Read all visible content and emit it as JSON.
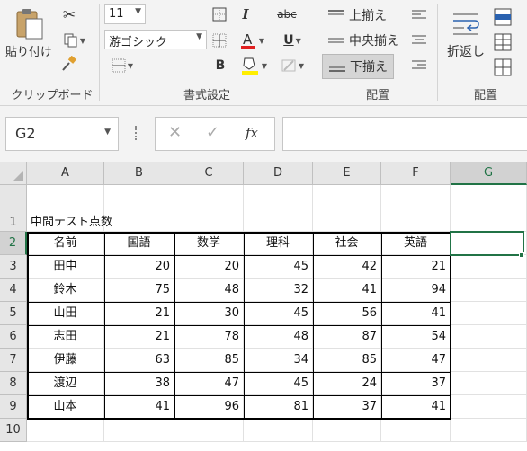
{
  "ribbon": {
    "clipboard": {
      "paste_label": "貼り付け",
      "group_label": "クリップボード"
    },
    "font": {
      "size": "11",
      "family": "游ゴシック",
      "group_label": "書式設定",
      "italic": "I",
      "strike": "abc",
      "bold": "B",
      "underline": "U"
    },
    "align": {
      "top": "上揃え",
      "middle": "中央揃え",
      "bottom": "下揃え",
      "group_label": "配置"
    },
    "wrap": {
      "label": "折返し",
      "group_label": "配置"
    }
  },
  "formula_bar": {
    "name_box": "G2",
    "fx": "fx"
  },
  "columns": [
    "A",
    "B",
    "C",
    "D",
    "E",
    "F",
    "G"
  ],
  "rows": [
    "1",
    "2",
    "3",
    "4",
    "5",
    "6",
    "7",
    "8",
    "9",
    "10"
  ],
  "sheet": {
    "title": "中間テスト点数",
    "headers": [
      "名前",
      "国語",
      "数学",
      "理科",
      "社会",
      "英語"
    ],
    "records": [
      [
        "田中",
        "20",
        "20",
        "45",
        "42",
        "21"
      ],
      [
        "鈴木",
        "75",
        "48",
        "32",
        "41",
        "94"
      ],
      [
        "山田",
        "21",
        "30",
        "45",
        "56",
        "41"
      ],
      [
        "志田",
        "21",
        "78",
        "48",
        "87",
        "54"
      ],
      [
        "伊藤",
        "63",
        "85",
        "34",
        "85",
        "47"
      ],
      [
        "渡辺",
        "38",
        "47",
        "45",
        "24",
        "37"
      ],
      [
        "山本",
        "41",
        "96",
        "81",
        "37",
        "41"
      ]
    ]
  },
  "accent_color": "#217346"
}
